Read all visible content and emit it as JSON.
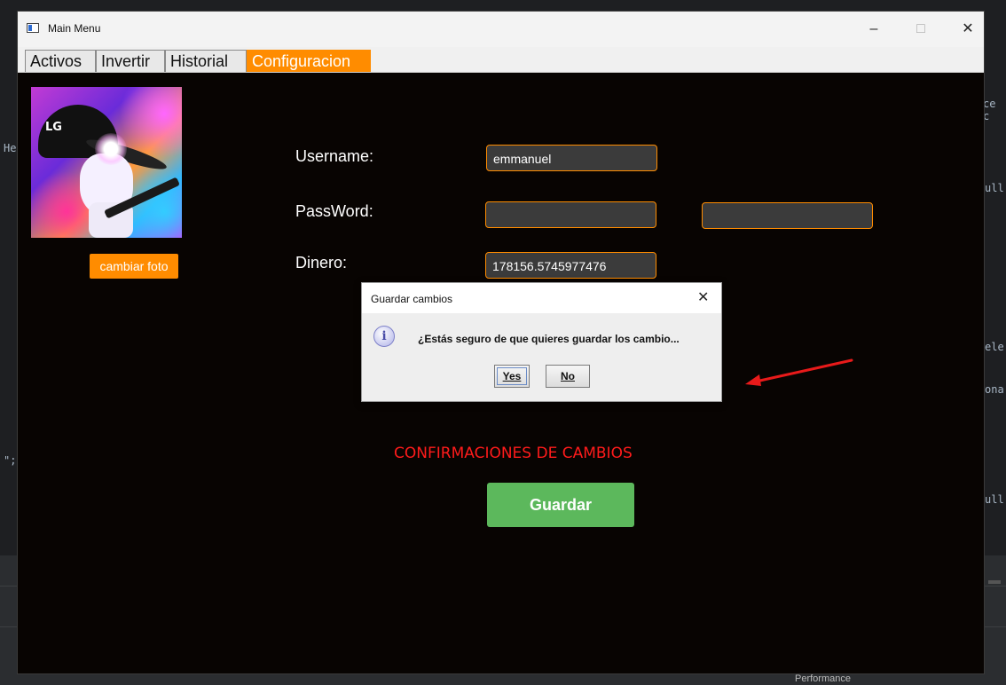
{
  "window": {
    "title": "Main Menu",
    "minimize": "–",
    "maximize": "□",
    "close": "✕"
  },
  "tabs": [
    {
      "label": "Activos",
      "active": false
    },
    {
      "label": "Invertir",
      "active": false
    },
    {
      "label": "Historial",
      "active": false
    },
    {
      "label": "Configuracion",
      "active": true
    }
  ],
  "profile": {
    "change_photo_label": "cambiar foto",
    "avatar_text": "LG"
  },
  "form": {
    "username_label": "Username:",
    "username_value": "emmanuel",
    "password_label": "PassWord:",
    "password_value": "",
    "password_confirm_value": "",
    "money_label": "Dinero:",
    "money_value": "178156.5745977476"
  },
  "confirm": {
    "heading": "CONFIRMACIONES DE CAMBIOS",
    "save_label": "Guardar"
  },
  "dialog": {
    "title": "Guardar cambios",
    "close": "✕",
    "icon_glyph": "i",
    "message": "¿Estás seguro de que quieres guardar los cambio...",
    "yes_label": "Yes",
    "no_label": "No"
  },
  "background": {
    "code_fragments": [
      "ce c",
      "He",
      "ull",
      "ele",
      "ona",
      "\";",
      "ull"
    ],
    "status_label": "Performance"
  },
  "colors": {
    "accent_orange": "#ff8c00",
    "save_green": "#5cb85c",
    "confirm_red": "#ff1b1b",
    "window_bg": "#080402",
    "annotation_arrow": "#e81a1a"
  }
}
